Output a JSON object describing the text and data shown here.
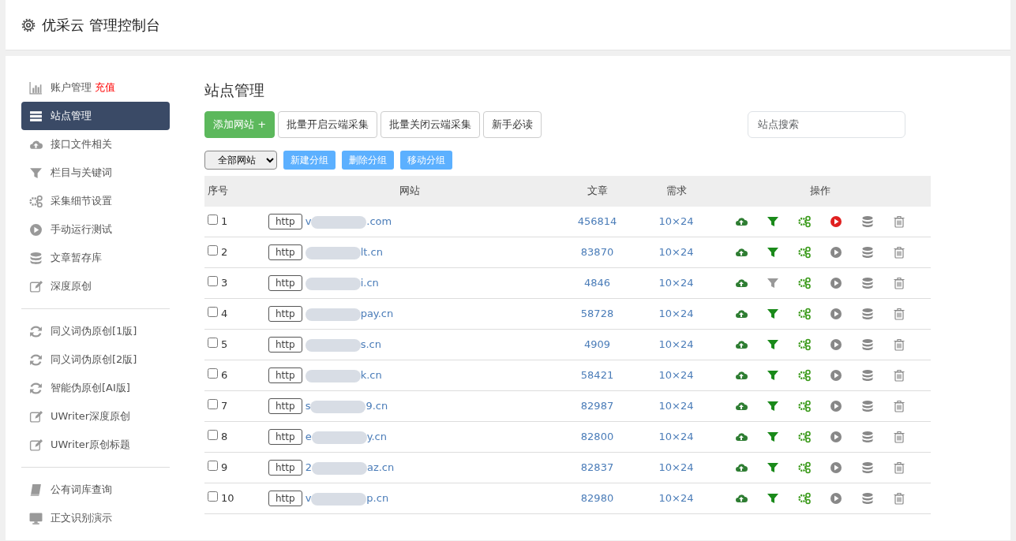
{
  "header": {
    "title": "优采云 管理控制台"
  },
  "sidebar": {
    "items": [
      {
        "kind": "chart",
        "label": "账户管理",
        "badge": "充值",
        "selected": false
      },
      {
        "kind": "server",
        "label": "站点管理",
        "selected": true
      },
      {
        "kind": "cloud",
        "label": "接口文件相关",
        "selected": false
      },
      {
        "kind": "filter",
        "label": "栏目与关键词",
        "selected": false
      },
      {
        "kind": "gears",
        "label": "采集细节设置",
        "selected": false
      },
      {
        "kind": "play",
        "label": "手动运行测试",
        "selected": false
      },
      {
        "kind": "database",
        "label": "文章暂存库",
        "selected": false
      },
      {
        "kind": "edit",
        "label": "深度原创",
        "selected": false
      },
      {
        "kind": "divider"
      },
      {
        "kind": "refresh",
        "label": "同义词伪原创[1版]",
        "selected": false
      },
      {
        "kind": "refresh",
        "label": "同义词伪原创[2版]",
        "selected": false
      },
      {
        "kind": "refresh",
        "label": "智能伪原创[AI版]",
        "selected": false
      },
      {
        "kind": "edit",
        "label": "UWriter深度原创",
        "selected": false
      },
      {
        "kind": "edit",
        "label": "UWriter原创标题",
        "selected": false
      },
      {
        "kind": "divider"
      },
      {
        "kind": "book",
        "label": "公有词库查询",
        "selected": false
      },
      {
        "kind": "monitor",
        "label": "正文识别演示",
        "selected": false
      }
    ]
  },
  "page_title": "站点管理",
  "toolbar": {
    "buttons": [
      {
        "kind": "primary",
        "label": "添加网站 +"
      },
      {
        "kind": "default",
        "label": "批量开启云端采集"
      },
      {
        "kind": "default",
        "label": "批量关闭云端采集"
      },
      {
        "kind": "default",
        "label": "新手必读"
      }
    ],
    "search": {
      "placeholder": "站点搜索"
    }
  },
  "group_bar": {
    "select": "全部网站",
    "buttons": [
      "新建分组",
      "删除分组",
      "移动分组"
    ]
  },
  "table": {
    "columns": [
      "序号",
      "网站",
      "文章",
      "需求",
      "操作"
    ],
    "rows": [
      {
        "index": "1",
        "checked": false,
        "protocol": "http",
        "domain_start": "v",
        "domain_end": ".com",
        "articles": "456814",
        "demand": "10×24",
        "filter_enabled": true,
        "running": true
      },
      {
        "index": "2",
        "checked": false,
        "protocol": "http",
        "domain_start": "",
        "domain_end": "lt.cn",
        "articles": "83870",
        "demand": "10×24",
        "filter_enabled": true,
        "running": false
      },
      {
        "index": "3",
        "checked": false,
        "protocol": "http",
        "domain_start": "",
        "domain_end": "i.cn",
        "articles": "4846",
        "demand": "10×24",
        "filter_enabled": false,
        "running": false
      },
      {
        "index": "4",
        "checked": false,
        "protocol": "http",
        "domain_start": "",
        "domain_end": "pay.cn",
        "articles": "58728",
        "demand": "10×24",
        "filter_enabled": true,
        "running": false
      },
      {
        "index": "5",
        "checked": false,
        "protocol": "http",
        "domain_start": "",
        "domain_end": "s.cn",
        "articles": "4909",
        "demand": "10×24",
        "filter_enabled": true,
        "running": false
      },
      {
        "index": "6",
        "checked": false,
        "protocol": "http",
        "domain_start": "",
        "domain_end": "k.cn",
        "articles": "58421",
        "demand": "10×24",
        "filter_enabled": true,
        "running": false
      },
      {
        "index": "7",
        "checked": false,
        "protocol": "http",
        "domain_start": "s",
        "domain_end": "9.cn",
        "articles": "82987",
        "demand": "10×24",
        "filter_enabled": true,
        "running": false
      },
      {
        "index": "8",
        "checked": false,
        "protocol": "http",
        "domain_start": "e",
        "domain_end": "y.cn",
        "articles": "82800",
        "demand": "10×24",
        "filter_enabled": true,
        "running": false
      },
      {
        "index": "9",
        "checked": false,
        "protocol": "http",
        "domain_start": "2",
        "domain_end": "az.cn",
        "articles": "82837",
        "demand": "10×24",
        "filter_enabled": true,
        "running": false
      },
      {
        "index": "10",
        "checked": false,
        "protocol": "http",
        "domain_start": "v",
        "domain_end": "p.cn",
        "articles": "82980",
        "demand": "10×24",
        "filter_enabled": true,
        "running": false
      }
    ]
  }
}
